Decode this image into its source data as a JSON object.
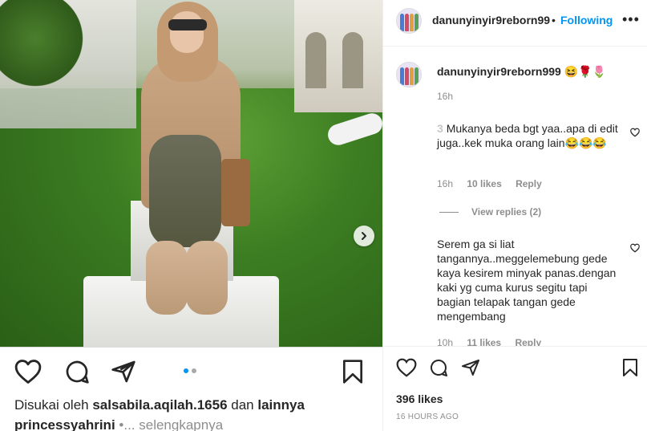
{
  "post": {
    "username": "danunyinyir9reborn99",
    "separator": "•",
    "follow_label": "Following",
    "more_label": "•••"
  },
  "caption": {
    "username": "danunyinyir9reborn999",
    "emojis": "😆🌹🌷",
    "time": "16h"
  },
  "comments": [
    {
      "user": "3",
      "text": "Mukanya beda bgt yaa..apa di edit juga..kek muka orang lain😂😂😂",
      "time": "16h",
      "likes": "10 likes",
      "reply_label": "Reply",
      "view_replies": "View replies (2)"
    },
    {
      "user": "",
      "text": "Serem ga si liat tangannya..meggelemebung gede kaya kesirem minyak panas.dengan kaki yg cuma kurus segitu tapi bagian telapak tangan gede mengembang",
      "time": "10h",
      "likes": "11 likes",
      "reply_label": "Reply"
    }
  ],
  "right_footer": {
    "likes": "396 likes",
    "posted": "16 HOURS AGO"
  },
  "left_footer": {
    "liked_prefix": "Disukai oleh ",
    "liked_user": "salsabila.aqilah.1656",
    "liked_mid": " dan ",
    "liked_others": "lainnya",
    "caption_user": "princessyahrini",
    "caption_more": " •... selengkapnya"
  },
  "carousel": {
    "current": 1,
    "total": 2
  },
  "colors": {
    "accent": "#0095f6",
    "text": "#262626",
    "muted": "#8e8e8e"
  },
  "icons": [
    "heart-icon",
    "comment-icon",
    "share-icon",
    "bookmark-icon",
    "chevron-right-icon"
  ]
}
